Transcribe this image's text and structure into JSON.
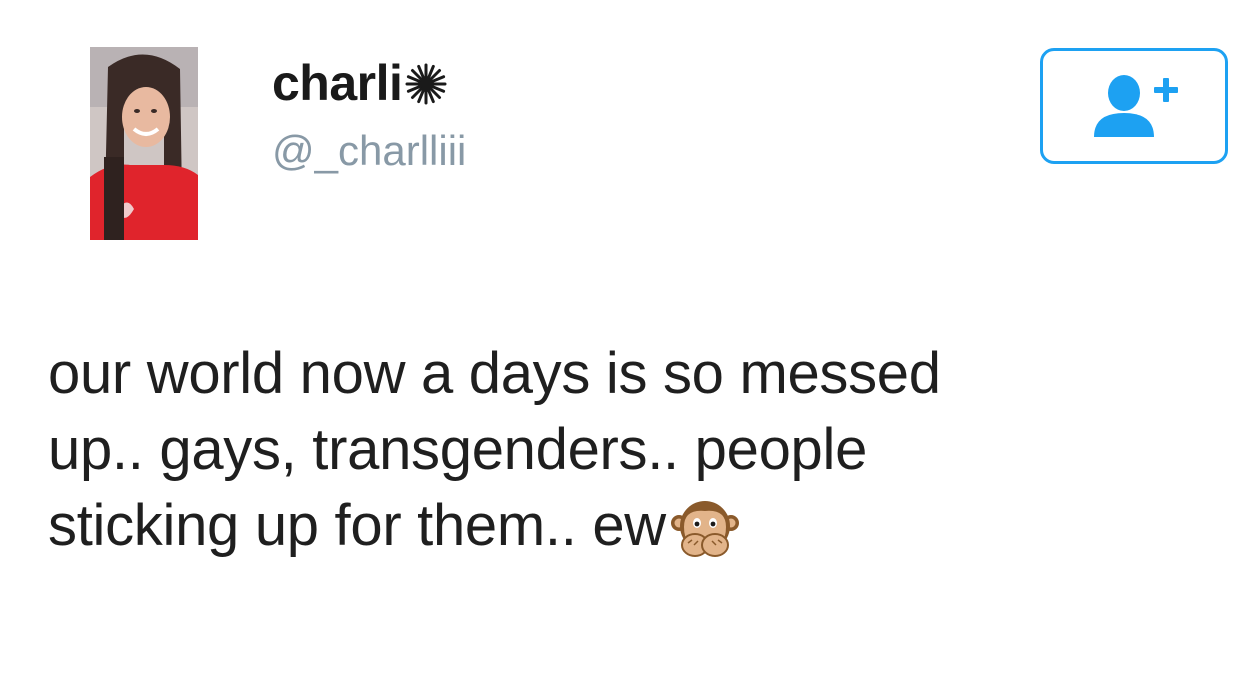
{
  "user": {
    "display_name": "charli",
    "name_decoration_icon": "sparkle-burst-icon",
    "handle": "@_charlliii",
    "avatar_icon": "profile-photo"
  },
  "follow_button": {
    "icon": "add-user-icon",
    "accent_color": "#1da1f2"
  },
  "tweet": {
    "lines": [
      "our world now a days is so messed",
      "up.. gays, transgenders.. people",
      "sticking up for them.. ew"
    ],
    "trailing_emoji": "speak-no-evil-monkey-icon"
  },
  "colors": {
    "text": "#1f1f1f",
    "handle": "#8899a6",
    "accent": "#1da1f2"
  }
}
